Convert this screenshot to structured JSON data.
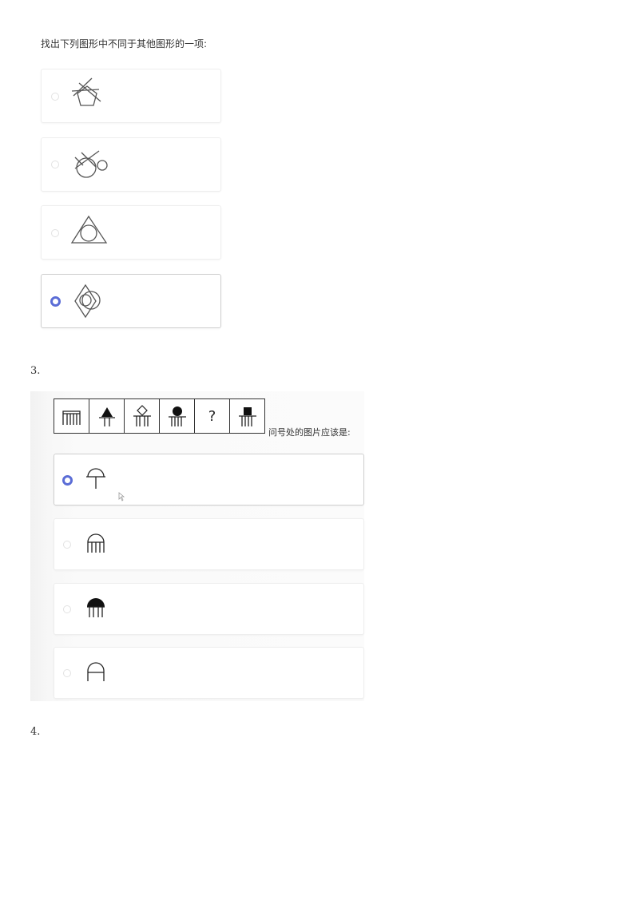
{
  "q2": {
    "prompt": "找出下列图形中不同于其他图形的一项:",
    "options": [
      {
        "figure": "pentagon-with-crossing-lines-icon",
        "selected": false
      },
      {
        "figure": "circles-with-crossing-lines-icon",
        "selected": false
      },
      {
        "figure": "circle-in-triangle-icon",
        "selected": false
      },
      {
        "figure": "diamond-with-circles-icon",
        "selected": true
      }
    ]
  },
  "q3": {
    "number": "3.",
    "sequence_cells": [
      "comb-arch-icon",
      "triangle-comb-icon",
      "diamond-comb-icon",
      "dot-comb-icon",
      "?",
      "square-comb-icon"
    ],
    "question_mark": "?",
    "suffix": "问号处的图片应该是:",
    "options": [
      {
        "figure": "arch-t-icon",
        "selected": true
      },
      {
        "figure": "arch-comb-icon",
        "selected": false
      },
      {
        "figure": "filled-dome-comb-icon",
        "selected": false
      },
      {
        "figure": "arch-two-legs-icon",
        "selected": false
      }
    ]
  },
  "q4": {
    "number": "4."
  },
  "colors": {
    "accent": "#5b6dd6",
    "border": "#eeeeee",
    "text": "#333333"
  }
}
